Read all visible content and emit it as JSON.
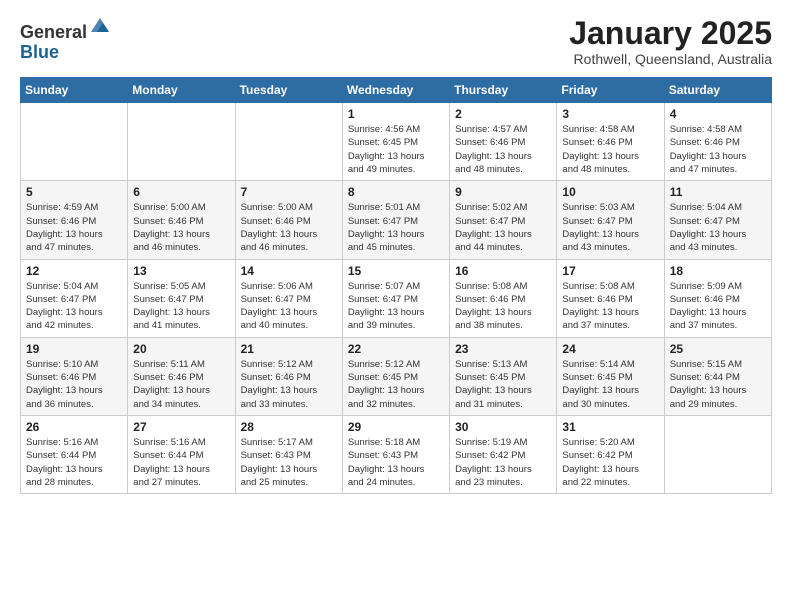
{
  "logo": {
    "general": "General",
    "blue": "Blue"
  },
  "header": {
    "month": "January 2025",
    "location": "Rothwell, Queensland, Australia"
  },
  "days_of_week": [
    "Sunday",
    "Monday",
    "Tuesday",
    "Wednesday",
    "Thursday",
    "Friday",
    "Saturday"
  ],
  "weeks": [
    [
      {
        "day": "",
        "info": ""
      },
      {
        "day": "",
        "info": ""
      },
      {
        "day": "",
        "info": ""
      },
      {
        "day": "1",
        "info": "Sunrise: 4:56 AM\nSunset: 6:45 PM\nDaylight: 13 hours\nand 49 minutes."
      },
      {
        "day": "2",
        "info": "Sunrise: 4:57 AM\nSunset: 6:46 PM\nDaylight: 13 hours\nand 48 minutes."
      },
      {
        "day": "3",
        "info": "Sunrise: 4:58 AM\nSunset: 6:46 PM\nDaylight: 13 hours\nand 48 minutes."
      },
      {
        "day": "4",
        "info": "Sunrise: 4:58 AM\nSunset: 6:46 PM\nDaylight: 13 hours\nand 47 minutes."
      }
    ],
    [
      {
        "day": "5",
        "info": "Sunrise: 4:59 AM\nSunset: 6:46 PM\nDaylight: 13 hours\nand 47 minutes."
      },
      {
        "day": "6",
        "info": "Sunrise: 5:00 AM\nSunset: 6:46 PM\nDaylight: 13 hours\nand 46 minutes."
      },
      {
        "day": "7",
        "info": "Sunrise: 5:00 AM\nSunset: 6:46 PM\nDaylight: 13 hours\nand 46 minutes."
      },
      {
        "day": "8",
        "info": "Sunrise: 5:01 AM\nSunset: 6:47 PM\nDaylight: 13 hours\nand 45 minutes."
      },
      {
        "day": "9",
        "info": "Sunrise: 5:02 AM\nSunset: 6:47 PM\nDaylight: 13 hours\nand 44 minutes."
      },
      {
        "day": "10",
        "info": "Sunrise: 5:03 AM\nSunset: 6:47 PM\nDaylight: 13 hours\nand 43 minutes."
      },
      {
        "day": "11",
        "info": "Sunrise: 5:04 AM\nSunset: 6:47 PM\nDaylight: 13 hours\nand 43 minutes."
      }
    ],
    [
      {
        "day": "12",
        "info": "Sunrise: 5:04 AM\nSunset: 6:47 PM\nDaylight: 13 hours\nand 42 minutes."
      },
      {
        "day": "13",
        "info": "Sunrise: 5:05 AM\nSunset: 6:47 PM\nDaylight: 13 hours\nand 41 minutes."
      },
      {
        "day": "14",
        "info": "Sunrise: 5:06 AM\nSunset: 6:47 PM\nDaylight: 13 hours\nand 40 minutes."
      },
      {
        "day": "15",
        "info": "Sunrise: 5:07 AM\nSunset: 6:47 PM\nDaylight: 13 hours\nand 39 minutes."
      },
      {
        "day": "16",
        "info": "Sunrise: 5:08 AM\nSunset: 6:46 PM\nDaylight: 13 hours\nand 38 minutes."
      },
      {
        "day": "17",
        "info": "Sunrise: 5:08 AM\nSunset: 6:46 PM\nDaylight: 13 hours\nand 37 minutes."
      },
      {
        "day": "18",
        "info": "Sunrise: 5:09 AM\nSunset: 6:46 PM\nDaylight: 13 hours\nand 37 minutes."
      }
    ],
    [
      {
        "day": "19",
        "info": "Sunrise: 5:10 AM\nSunset: 6:46 PM\nDaylight: 13 hours\nand 36 minutes."
      },
      {
        "day": "20",
        "info": "Sunrise: 5:11 AM\nSunset: 6:46 PM\nDaylight: 13 hours\nand 34 minutes."
      },
      {
        "day": "21",
        "info": "Sunrise: 5:12 AM\nSunset: 6:46 PM\nDaylight: 13 hours\nand 33 minutes."
      },
      {
        "day": "22",
        "info": "Sunrise: 5:12 AM\nSunset: 6:45 PM\nDaylight: 13 hours\nand 32 minutes."
      },
      {
        "day": "23",
        "info": "Sunrise: 5:13 AM\nSunset: 6:45 PM\nDaylight: 13 hours\nand 31 minutes."
      },
      {
        "day": "24",
        "info": "Sunrise: 5:14 AM\nSunset: 6:45 PM\nDaylight: 13 hours\nand 30 minutes."
      },
      {
        "day": "25",
        "info": "Sunrise: 5:15 AM\nSunset: 6:44 PM\nDaylight: 13 hours\nand 29 minutes."
      }
    ],
    [
      {
        "day": "26",
        "info": "Sunrise: 5:16 AM\nSunset: 6:44 PM\nDaylight: 13 hours\nand 28 minutes."
      },
      {
        "day": "27",
        "info": "Sunrise: 5:16 AM\nSunset: 6:44 PM\nDaylight: 13 hours\nand 27 minutes."
      },
      {
        "day": "28",
        "info": "Sunrise: 5:17 AM\nSunset: 6:43 PM\nDaylight: 13 hours\nand 25 minutes."
      },
      {
        "day": "29",
        "info": "Sunrise: 5:18 AM\nSunset: 6:43 PM\nDaylight: 13 hours\nand 24 minutes."
      },
      {
        "day": "30",
        "info": "Sunrise: 5:19 AM\nSunset: 6:42 PM\nDaylight: 13 hours\nand 23 minutes."
      },
      {
        "day": "31",
        "info": "Sunrise: 5:20 AM\nSunset: 6:42 PM\nDaylight: 13 hours\nand 22 minutes."
      },
      {
        "day": "",
        "info": ""
      }
    ]
  ]
}
